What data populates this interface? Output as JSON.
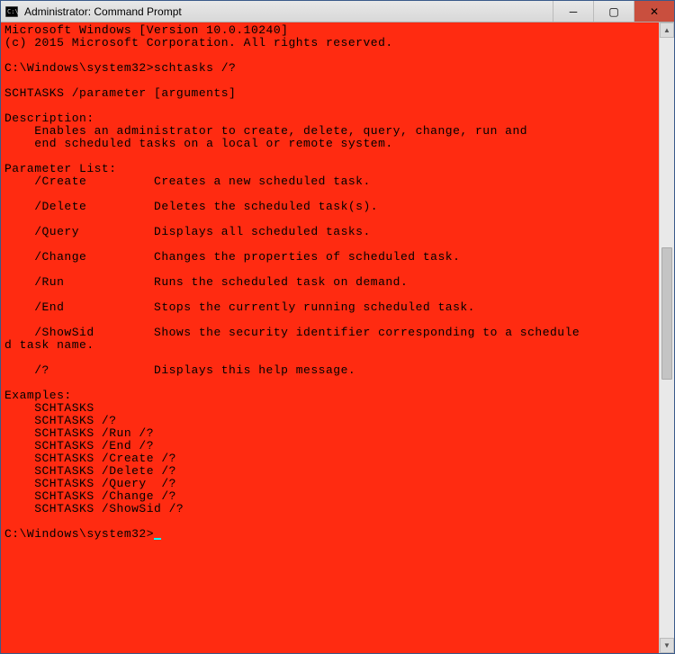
{
  "window": {
    "title": "Administrator: Command Prompt"
  },
  "controls": {
    "minimize": "─",
    "maximize": "▢",
    "close": "✕"
  },
  "console": {
    "header1": "Microsoft Windows [Version 10.0.10240]",
    "header2": "(c) 2015 Microsoft Corporation. All rights reserved.",
    "prompt1": "C:\\Windows\\system32>",
    "command1": "schtasks /?",
    "syntax": "SCHTASKS /parameter [arguments]",
    "descHeader": "Description:",
    "descLine1": "    Enables an administrator to create, delete, query, change, run and",
    "descLine2": "    end scheduled tasks on a local or remote system.",
    "paramHeader": "Parameter List:",
    "params": [
      {
        "name": "    /Create         ",
        "desc": "Creates a new scheduled task."
      },
      {
        "name": "    /Delete         ",
        "desc": "Deletes the scheduled task(s)."
      },
      {
        "name": "    /Query          ",
        "desc": "Displays all scheduled tasks."
      },
      {
        "name": "    /Change         ",
        "desc": "Changes the properties of scheduled task."
      },
      {
        "name": "    /Run            ",
        "desc": "Runs the scheduled task on demand."
      },
      {
        "name": "    /End            ",
        "desc": "Stops the currently running scheduled task."
      },
      {
        "name": "    /ShowSid        ",
        "desc": "Shows the security identifier corresponding to a schedule"
      }
    ],
    "showSidWrap": "d task name.",
    "helpParam": "    /?              ",
    "helpDesc": "Displays this help message.",
    "examplesHeader": "Examples:",
    "examples": [
      "    SCHTASKS",
      "    SCHTASKS /?",
      "    SCHTASKS /Run /?",
      "    SCHTASKS /End /?",
      "    SCHTASKS /Create /?",
      "    SCHTASKS /Delete /?",
      "    SCHTASKS /Query  /?",
      "    SCHTASKS /Change /?",
      "    SCHTASKS /ShowSid /?"
    ],
    "prompt2": "C:\\Windows\\system32>"
  }
}
